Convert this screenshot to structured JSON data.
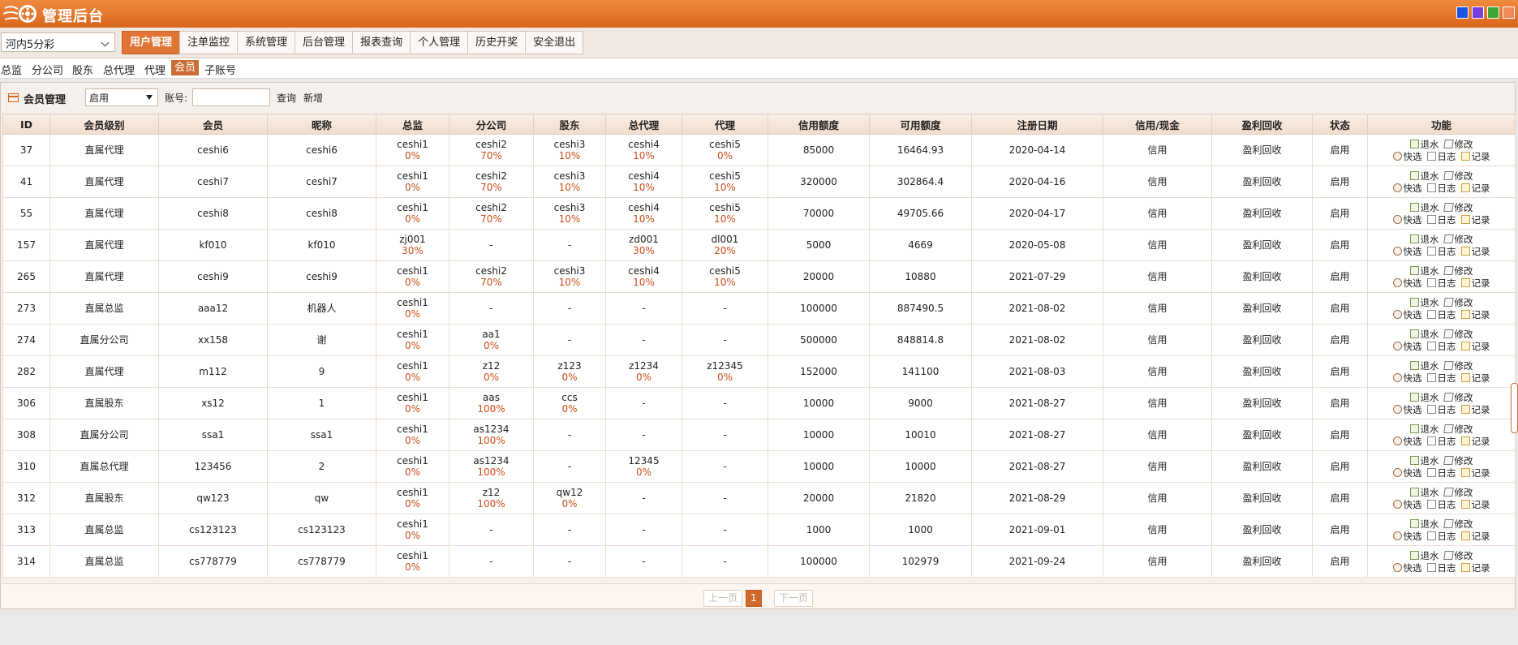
{
  "header": {
    "title": "管理后台",
    "swatch_colors": [
      "#1a56e6",
      "#7a3ee0",
      "#3fa535",
      "#f08a5a"
    ]
  },
  "lottery_select": {
    "value": "河内5分彩"
  },
  "main_nav": [
    "用户管理",
    "注单监控",
    "系统管理",
    "后台管理",
    "报表查询",
    "个人管理",
    "历史开奖",
    "安全退出"
  ],
  "sub_nav": [
    "总监",
    "分公司",
    "股东",
    "总代理",
    "代理",
    "会员",
    "子账号"
  ],
  "toolbar": {
    "title": "会员管理",
    "status_value": "启用",
    "account_label": "账号:",
    "account_value": "",
    "query": "查询",
    "add": "新增"
  },
  "columns": [
    "ID",
    "会员级别",
    "会员",
    "昵称",
    "总监",
    "分公司",
    "股东",
    "总代理",
    "代理",
    "信用额度",
    "可用额度",
    "注册日期",
    "信用/现金",
    "盈利回收",
    "状态",
    "功能"
  ],
  "actions": [
    "退水",
    "修改",
    "快选",
    "日志",
    "记录"
  ],
  "rows": [
    {
      "id": "37",
      "level": "直属代理",
      "member": "ceshi6",
      "nick": "ceshi6",
      "zj": "ceshi1",
      "zj_p": "0%",
      "fgs": "ceshi2",
      "fgs_p": "70%",
      "gd": "ceshi3",
      "gd_p": "10%",
      "zdl": "ceshi4",
      "zdl_p": "10%",
      "dl": "ceshi5",
      "dl_p": "0%",
      "credit": "85000",
      "avail": "16464.93",
      "date": "2020-04-14",
      "type": "信用",
      "profit": "盈利回收",
      "status": "启用"
    },
    {
      "id": "41",
      "level": "直属代理",
      "member": "ceshi7",
      "nick": "ceshi7",
      "zj": "ceshi1",
      "zj_p": "0%",
      "fgs": "ceshi2",
      "fgs_p": "70%",
      "gd": "ceshi3",
      "gd_p": "10%",
      "zdl": "ceshi4",
      "zdl_p": "10%",
      "dl": "ceshi5",
      "dl_p": "10%",
      "credit": "320000",
      "avail": "302864.4",
      "date": "2020-04-16",
      "type": "信用",
      "profit": "盈利回收",
      "status": "启用"
    },
    {
      "id": "55",
      "level": "直属代理",
      "member": "ceshi8",
      "nick": "ceshi8",
      "zj": "ceshi1",
      "zj_p": "0%",
      "fgs": "ceshi2",
      "fgs_p": "70%",
      "gd": "ceshi3",
      "gd_p": "10%",
      "zdl": "ceshi4",
      "zdl_p": "10%",
      "dl": "ceshi5",
      "dl_p": "10%",
      "credit": "70000",
      "avail": "49705.66",
      "date": "2020-04-17",
      "type": "信用",
      "profit": "盈利回收",
      "status": "启用"
    },
    {
      "id": "157",
      "level": "直属代理",
      "member": "kf010",
      "nick": "kf010",
      "zj": "zj001",
      "zj_p": "30%",
      "fgs": "-",
      "fgs_p": "",
      "gd": "-",
      "gd_p": "",
      "zdl": "zd001",
      "zdl_p": "30%",
      "dl": "dl001",
      "dl_p": "20%",
      "credit": "5000",
      "avail": "4669",
      "date": "2020-05-08",
      "type": "信用",
      "profit": "盈利回收",
      "status": "启用"
    },
    {
      "id": "265",
      "level": "直属代理",
      "member": "ceshi9",
      "nick": "ceshi9",
      "zj": "ceshi1",
      "zj_p": "0%",
      "fgs": "ceshi2",
      "fgs_p": "70%",
      "gd": "ceshi3",
      "gd_p": "10%",
      "zdl": "ceshi4",
      "zdl_p": "10%",
      "dl": "ceshi5",
      "dl_p": "10%",
      "credit": "20000",
      "avail": "10880",
      "date": "2021-07-29",
      "type": "信用",
      "profit": "盈利回收",
      "status": "启用"
    },
    {
      "id": "273",
      "level": "直属总监",
      "member": "aaa12",
      "nick": "机器人",
      "zj": "ceshi1",
      "zj_p": "0%",
      "fgs": "-",
      "fgs_p": "",
      "gd": "-",
      "gd_p": "",
      "zdl": "-",
      "zdl_p": "",
      "dl": "-",
      "dl_p": "",
      "credit": "100000",
      "avail": "887490.5",
      "date": "2021-08-02",
      "type": "信用",
      "profit": "盈利回收",
      "status": "启用"
    },
    {
      "id": "274",
      "level": "直属分公司",
      "member": "xx158",
      "nick": "谢",
      "zj": "ceshi1",
      "zj_p": "0%",
      "fgs": "aa1",
      "fgs_p": "0%",
      "gd": "-",
      "gd_p": "",
      "zdl": "-",
      "zdl_p": "",
      "dl": "-",
      "dl_p": "",
      "credit": "500000",
      "avail": "848814.8",
      "date": "2021-08-02",
      "type": "信用",
      "profit": "盈利回收",
      "status": "启用"
    },
    {
      "id": "282",
      "level": "直属代理",
      "member": "m112",
      "nick": "9",
      "zj": "ceshi1",
      "zj_p": "0%",
      "fgs": "z12",
      "fgs_p": "0%",
      "gd": "z123",
      "gd_p": "0%",
      "zdl": "z1234",
      "zdl_p": "0%",
      "dl": "z12345",
      "dl_p": "0%",
      "credit": "152000",
      "avail": "141100",
      "date": "2021-08-03",
      "type": "信用",
      "profit": "盈利回收",
      "status": "启用"
    },
    {
      "id": "306",
      "level": "直属股东",
      "member": "xs12",
      "nick": "1",
      "zj": "ceshi1",
      "zj_p": "0%",
      "fgs": "aas",
      "fgs_p": "100%",
      "gd": "ccs",
      "gd_p": "0%",
      "zdl": "-",
      "zdl_p": "",
      "dl": "-",
      "dl_p": "",
      "credit": "10000",
      "avail": "9000",
      "date": "2021-08-27",
      "type": "信用",
      "profit": "盈利回收",
      "status": "启用"
    },
    {
      "id": "308",
      "level": "直属分公司",
      "member": "ssa1",
      "nick": "ssa1",
      "zj": "ceshi1",
      "zj_p": "0%",
      "fgs": "as1234",
      "fgs_p": "100%",
      "gd": "-",
      "gd_p": "",
      "zdl": "-",
      "zdl_p": "",
      "dl": "-",
      "dl_p": "",
      "credit": "10000",
      "avail": "10010",
      "date": "2021-08-27",
      "type": "信用",
      "profit": "盈利回收",
      "status": "启用"
    },
    {
      "id": "310",
      "level": "直属总代理",
      "member": "123456",
      "nick": "2",
      "zj": "ceshi1",
      "zj_p": "0%",
      "fgs": "as1234",
      "fgs_p": "100%",
      "gd": "-",
      "gd_p": "",
      "zdl": "12345",
      "zdl_p": "0%",
      "dl": "-",
      "dl_p": "",
      "credit": "10000",
      "avail": "10000",
      "date": "2021-08-27",
      "type": "信用",
      "profit": "盈利回收",
      "status": "启用"
    },
    {
      "id": "312",
      "level": "直属股东",
      "member": "qw123",
      "nick": "qw",
      "zj": "ceshi1",
      "zj_p": "0%",
      "fgs": "z12",
      "fgs_p": "100%",
      "gd": "qw12",
      "gd_p": "0%",
      "zdl": "-",
      "zdl_p": "",
      "dl": "-",
      "dl_p": "",
      "credit": "20000",
      "avail": "21820",
      "date": "2021-08-29",
      "type": "信用",
      "profit": "盈利回收",
      "status": "启用"
    },
    {
      "id": "313",
      "level": "直属总监",
      "member": "cs123123",
      "nick": "cs123123",
      "zj": "ceshi1",
      "zj_p": "0%",
      "fgs": "-",
      "fgs_p": "",
      "gd": "-",
      "gd_p": "",
      "zdl": "-",
      "zdl_p": "",
      "dl": "-",
      "dl_p": "",
      "credit": "1000",
      "avail": "1000",
      "date": "2021-09-01",
      "type": "信用",
      "profit": "盈利回收",
      "status": "启用"
    },
    {
      "id": "314",
      "level": "直属总监",
      "member": "cs778779",
      "nick": "cs778779",
      "zj": "ceshi1",
      "zj_p": "0%",
      "fgs": "-",
      "fgs_p": "",
      "gd": "-",
      "gd_p": "",
      "zdl": "-",
      "zdl_p": "",
      "dl": "-",
      "dl_p": "",
      "credit": "100000",
      "avail": "102979",
      "date": "2021-09-24",
      "type": "信用",
      "profit": "盈利回收",
      "status": "启用"
    }
  ],
  "pager": {
    "prev": "上一页",
    "current": "1",
    "next": "下一页"
  }
}
